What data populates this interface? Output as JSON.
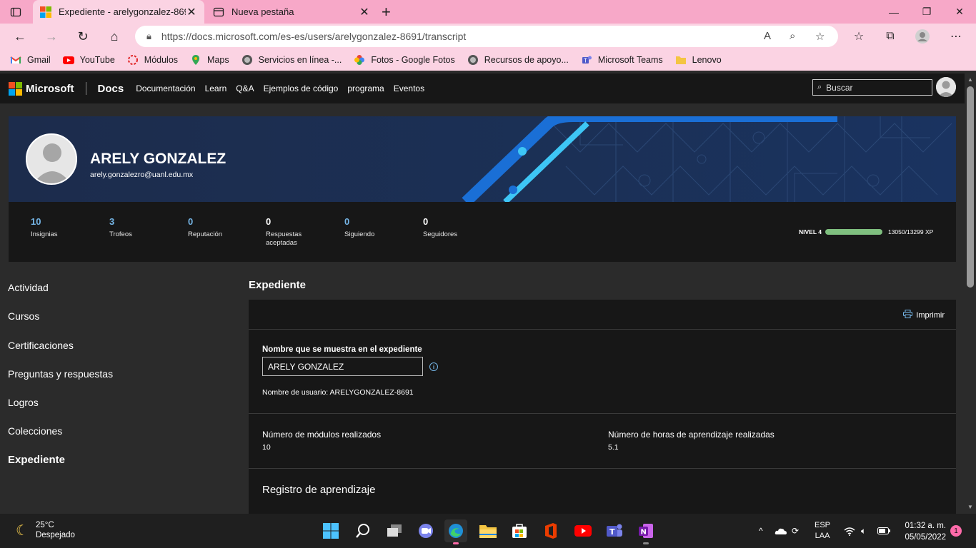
{
  "browser": {
    "tabs": [
      {
        "title": "Expediente - arelygonzalez-8691",
        "active": true
      },
      {
        "title": "Nueva pestaña",
        "active": false
      }
    ],
    "url": "https://docs.microsoft.com/es-es/users/arelygonzalez-8691/transcript",
    "bookmarks": [
      {
        "label": "Gmail",
        "icon": "gmail-icon"
      },
      {
        "label": "YouTube",
        "icon": "youtube-icon"
      },
      {
        "label": "Módulos",
        "icon": "modules-icon"
      },
      {
        "label": "Maps",
        "icon": "maps-icon"
      },
      {
        "label": "Servicios en línea -...",
        "icon": "uanl-icon"
      },
      {
        "label": "Fotos - Google Fotos",
        "icon": "photos-icon"
      },
      {
        "label": "Recursos de apoyo...",
        "icon": "uanl-icon"
      },
      {
        "label": "Microsoft Teams",
        "icon": "teams-icon"
      },
      {
        "label": "Lenovo",
        "icon": "folder-icon"
      }
    ]
  },
  "header": {
    "brand": "Microsoft",
    "product": "Docs",
    "nav": [
      "Documentación",
      "Learn",
      "Q&A",
      "Ejemplos de código",
      "programa",
      "Eventos"
    ],
    "search_placeholder": "Buscar"
  },
  "profile": {
    "name": "ARELY GONZALEZ",
    "email": "arely.gonzalezro@uanl.edu.mx",
    "stats": [
      {
        "value": "10",
        "label": "Insignias",
        "highlight": true
      },
      {
        "value": "3",
        "label": "Trofeos",
        "highlight": true
      },
      {
        "value": "0",
        "label": "Reputación",
        "highlight": true
      },
      {
        "value": "0",
        "label": "Respuestas aceptadas",
        "highlight": false
      },
      {
        "value": "0",
        "label": "Siguiendo",
        "highlight": true
      },
      {
        "value": "0",
        "label": "Seguidores",
        "highlight": false
      }
    ],
    "level": "NIVEL 4",
    "xp": "13050/13299 XP",
    "xp_progress": 0.98
  },
  "sidebar": {
    "items": [
      "Actividad",
      "Cursos",
      "Certificaciones",
      "Preguntas y respuestas",
      "Logros",
      "Colecciones",
      "Expediente"
    ],
    "active": "Expediente"
  },
  "transcript": {
    "title": "Expediente",
    "print_label": "Imprimir",
    "display_name_label": "Nombre que se muestra en el expediente",
    "display_name_value": "ARELY GONZALEZ",
    "username": "Nombre de usuario: ARELYGONZALEZ-8691",
    "modules_label": "Número de módulos realizados",
    "modules_value": "10",
    "hours_label": "Número de horas de aprendizaje realizadas",
    "hours_value": "5.1",
    "registro_title": "Registro de aprendizaje"
  },
  "taskbar": {
    "weather_temp": "25°C",
    "weather_desc": "Despejado",
    "lang_top": "ESP",
    "lang_bottom": "LAA",
    "time": "01:32 a. m.",
    "date": "05/05/2022",
    "notifications": "1"
  },
  "colors": {
    "accent_blue": "#75b6e7",
    "xp_bar": "#7fbf7f",
    "chrome_pink": "#f7a8c8"
  }
}
